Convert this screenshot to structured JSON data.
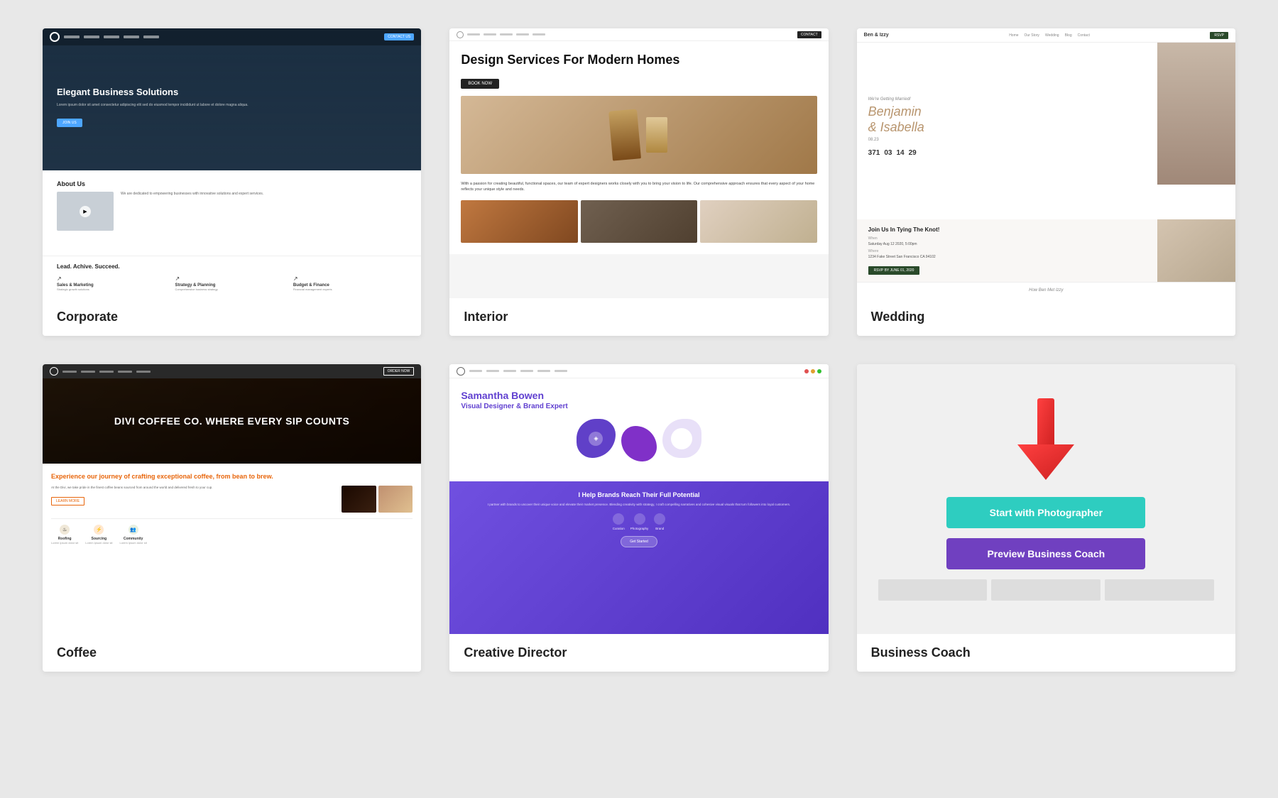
{
  "grid": {
    "cards": [
      {
        "id": "corporate",
        "label": "Corporate",
        "preview_type": "corporate",
        "hero_title": "Elegant Business Solutions",
        "hero_text": "Lorem ipsum dolor sit amet consectetur adipiscing elit sed do eiusmod tempor incididunt ut labore et dolore magna aliqua.",
        "hero_btn": "JOIN US",
        "nav_btn": "CONTACT US",
        "about_title": "About Us",
        "about_text": "We are dedicated to empowering businesses with innovative solutions and expert services.",
        "play_icon": "▶",
        "stats_title": "Lead. Achive. Succeed.",
        "stats": [
          {
            "arrow": "↗",
            "name": "Sales & Marketing",
            "desc": "Strategic growth solutions"
          },
          {
            "arrow": "↗",
            "name": "Strategy & Planning",
            "desc": "Comprehensive business strategy"
          },
          {
            "arrow": "↗",
            "name": "Budget & Finance",
            "desc": "Financial management experts"
          }
        ]
      },
      {
        "id": "interior",
        "label": "Interior",
        "preview_type": "interior",
        "title": "Design Services For Modern Homes",
        "btn": "BOOK NOW",
        "desc": "With a passion for creating beautiful, functional spaces, our team of expert designers works closely with you to bring your vision to life. Our comprehensive approach ensures that every aspect of your home reflects your unique style and needs."
      },
      {
        "id": "wedding",
        "label": "Wedding",
        "preview_type": "wedding",
        "getting_married": "We're Getting Married!",
        "names": "Benjamin\n& Isabella",
        "date": "08.23",
        "countdown": [
          {
            "num": "371",
            "label": ""
          },
          {
            "num": "03",
            "label": ""
          },
          {
            "num": "14",
            "label": ""
          },
          {
            "num": "29",
            "label": ""
          }
        ],
        "invite_title": "Join Us In Tying The Knot!",
        "when_label": "When",
        "when_value": "Saturday Aug 12 2020, 5:00pm",
        "where_label": "Where",
        "where_value": "1234 Fake Street\nSan Francisco CA 94102",
        "rsvp_btn": "RSVP BY JUNE 01, 2020",
        "footer": "How Ben Met Izzy"
      },
      {
        "id": "coffee",
        "label": "Coffee",
        "preview_type": "coffee",
        "hero_title": "DIVI COFFEE CO. WHERE EVERY SIP COUNTS",
        "nav_btn": "ORDER NOW",
        "orange_title": "Experience our journey of crafting exceptional coffee, from bean to brew.",
        "body_text": "At the Divi, we take pride in the finest coffee beans sourced from around the world and delivered fresh to your cup.",
        "link_btn": "LEARN MORE",
        "icons": [
          {
            "icon": "♨",
            "name": "Roofing",
            "desc": "Lorem ipsum dolor sit"
          },
          {
            "icon": "⚡",
            "name": "Sourcing",
            "desc": "Lorem ipsum dolor sit"
          },
          {
            "icon": "👥",
            "name": "Community",
            "desc": "Lorem ipsum dolor sit"
          }
        ]
      },
      {
        "id": "creative-director",
        "label": "Creative Director",
        "preview_type": "creative",
        "nav_dots": [
          "#e05050",
          "#e0a030",
          "#30c030"
        ],
        "person_name": "Samantha Bowen",
        "person_title": "Visual Designer & Brand Expert",
        "lower_title": "I Help Brands Reach Their Full Potential",
        "lower_text": "I partner with brands to uncover their unique voice and elevate their market presence. Blending creativity with strategy, I craft compelling narratives and cohesive visual visuals that turn followers into loyal customers.",
        "services": [
          {
            "name": "Curation"
          },
          {
            "name": "Photography"
          },
          {
            "name": "Brand"
          }
        ],
        "cta_btn": "Get Started"
      },
      {
        "id": "business-coach",
        "label": "Business Coach",
        "preview_type": "business",
        "btn_start": "Start with Photographer",
        "btn_preview": "Preview Business Coach",
        "arrow_color": "#e03030"
      }
    ]
  }
}
